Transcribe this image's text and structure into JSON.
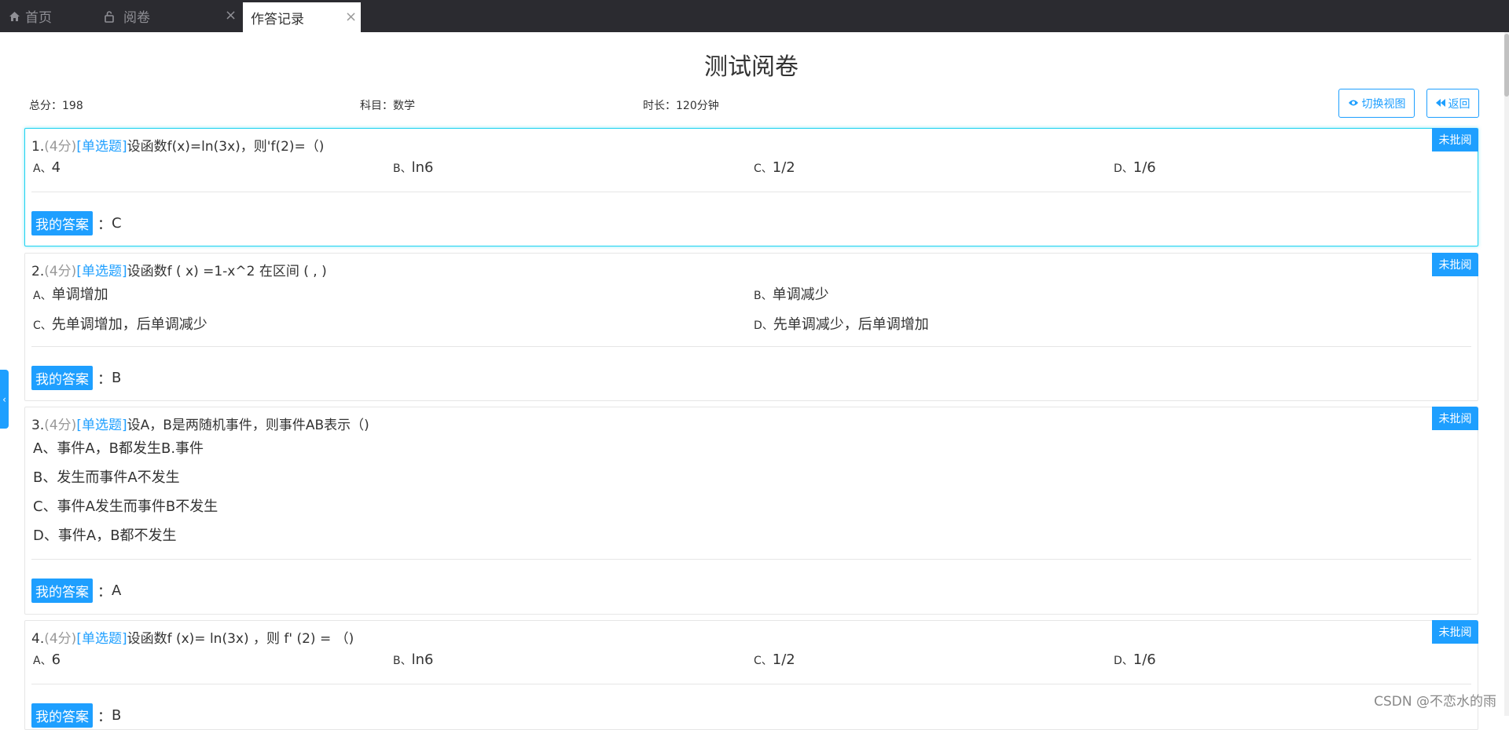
{
  "tabs": {
    "home": "首页",
    "review": "阅卷",
    "record": "作答记录",
    "close_glyph": "×"
  },
  "header": {
    "title": "测试阅卷",
    "total_score": "总分：198",
    "subject": "科目：数学",
    "duration": "时长：120分钟",
    "switch_view": "切换视图",
    "back": "返回"
  },
  "common": {
    "status_badge": "未批阅",
    "answer_label": "我的答案",
    "answer_sep": "："
  },
  "questions": [
    {
      "number": "1.",
      "score": "(4分)",
      "type": "[单选题]",
      "stem": "设函数f(x)=ln(3x)，则'f(2)=（)",
      "options": [
        {
          "letter": "A、",
          "text": "4"
        },
        {
          "letter": "B、",
          "text": "ln6"
        },
        {
          "letter": "C、",
          "text": "1/2"
        },
        {
          "letter": "D、",
          "text": "1/6"
        }
      ],
      "answer": "C"
    },
    {
      "number": "2.",
      "score": "(4分)",
      "type": "[单选题]",
      "stem": "设函数f ( x) =1-x^2 在区间 ( , )",
      "options": [
        {
          "letter": "A、",
          "text": "单调增加"
        },
        {
          "letter": "B、",
          "text": "单调减少"
        },
        {
          "letter": "C、",
          "text": "先单调增加，后单调减少"
        },
        {
          "letter": "D、",
          "text": "先单调减少，后单调增加"
        }
      ],
      "answer": "B"
    },
    {
      "number": "3.",
      "score": "(4分)",
      "type": "[单选题]",
      "stem": "设A，B是两随机事件，则事件AB表示（)",
      "options": [
        {
          "letter": "A、",
          "text": "事件A，B都发生B.事件"
        },
        {
          "letter": "B、",
          "text": "发生而事件A不发生"
        },
        {
          "letter": "C、",
          "text": "事件A发生而事件B不发生"
        },
        {
          "letter": "D、",
          "text": "事件A，B都不发生"
        }
      ],
      "answer": "A"
    },
    {
      "number": "4.",
      "score": "(4分)",
      "type": "[单选题]",
      "stem": "设函数f (x)= ln(3x) ，则  f' (2) = （)",
      "options": [
        {
          "letter": "A、",
          "text": "6"
        },
        {
          "letter": "B、",
          "text": "ln6"
        },
        {
          "letter": "C、",
          "text": "1/2"
        },
        {
          "letter": "D、",
          "text": "1/6"
        }
      ],
      "answer": "B"
    }
  ],
  "watermark": "CSDN @不恋水的雨",
  "colors": {
    "accent": "#1e9fff",
    "active_border": "#1fd3f0",
    "tabbar_bg": "#2b2b30"
  }
}
